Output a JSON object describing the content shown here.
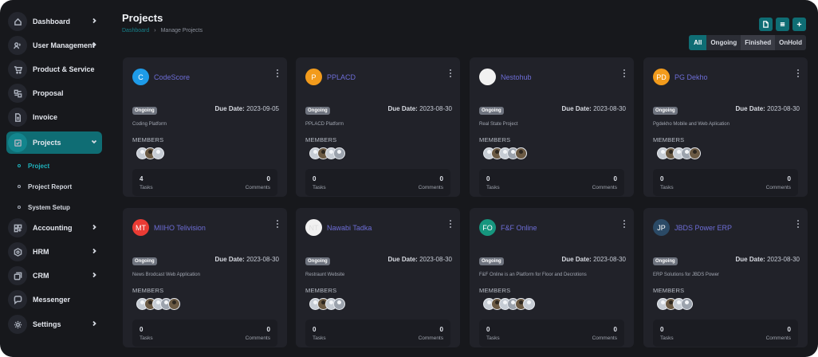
{
  "sidebar": {
    "items": [
      {
        "label": "Dashboard",
        "icon": "home-icon",
        "chevron": true
      },
      {
        "label": "User Management",
        "icon": "users-icon",
        "chevron": true
      },
      {
        "label": "Product & Service",
        "icon": "cart-icon",
        "chevron": false
      },
      {
        "label": "Proposal",
        "icon": "proposal-icon",
        "chevron": false
      },
      {
        "label": "Invoice",
        "icon": "invoice-icon",
        "chevron": false
      },
      {
        "label": "Projects",
        "icon": "projects-icon",
        "chevron": true,
        "active": true
      },
      {
        "label": "Accounting",
        "icon": "accounting-icon",
        "chevron": true
      },
      {
        "label": "HRM",
        "icon": "hrm-icon",
        "chevron": true
      },
      {
        "label": "CRM",
        "icon": "crm-icon",
        "chevron": true
      },
      {
        "label": "Messenger",
        "icon": "messenger-icon",
        "chevron": false
      },
      {
        "label": "Settings",
        "icon": "gear-icon",
        "chevron": true
      }
    ],
    "sub_items": [
      {
        "label": "Project",
        "active": true
      },
      {
        "label": "Project Report"
      },
      {
        "label": "System Setup"
      }
    ]
  },
  "header": {
    "title": "Projects",
    "breadcrumb": {
      "home": "Dashboard",
      "separator": "›",
      "current": "Manage Projects"
    },
    "tools": [
      "export-icon",
      "list-icon",
      "plus-icon"
    ],
    "filters": [
      "All",
      "Ongoing",
      "Finished",
      "OnHold"
    ]
  },
  "colors": {
    "accent": "#0f6d74",
    "accent_text": "#1fb3bd",
    "project_name": "#6d6dd6"
  },
  "projects": [
    {
      "initials": "C",
      "avatar_color": "#1e9be8",
      "name": "CodeScore",
      "status": "Ongoing",
      "due_label": "Due Date:",
      "due": "2023-09-05",
      "desc": "Coding Platform",
      "members_label": "MEMBERS",
      "members": 3,
      "tasks": "4",
      "tasks_label": "Tasks",
      "comments": "0",
      "comments_label": "Comments"
    },
    {
      "initials": "P",
      "avatar_color": "#f29b1c",
      "name": "PPLACD",
      "status": "Ongoing",
      "due_label": "Due Date:",
      "due": "2023-08-30",
      "desc": "PPLACD Platform",
      "members_label": "MEMBERS",
      "members": 4,
      "tasks": "0",
      "tasks_label": "Tasks",
      "comments": "0",
      "comments_label": "Comments"
    },
    {
      "initials": "",
      "avatar_color": "#f1f1f1",
      "name": "Nestohub",
      "status": "Ongoing",
      "due_label": "Due Date:",
      "due": "2023-08-30",
      "desc": "Real State Project",
      "members_label": "MEMBERS",
      "members": 5,
      "tasks": "0",
      "tasks_label": "Tasks",
      "comments": "0",
      "comments_label": "Comments"
    },
    {
      "initials": "PD",
      "avatar_color": "#f29b1c",
      "name": "PG Dekho",
      "status": "Ongoing",
      "due_label": "Due Date:",
      "due": "2023-08-30",
      "desc": "Pgdekho Mobile and Web Aplication",
      "members_label": "MEMBERS",
      "members": 5,
      "tasks": "0",
      "tasks_label": "Tasks",
      "comments": "0",
      "comments_label": "Comments"
    },
    {
      "initials": "MT",
      "avatar_color": "#ea3b34",
      "name": "MIIHO Telivision",
      "status": "Ongoing",
      "due_label": "Due Date:",
      "due": "2023-08-30",
      "desc": "News Brodcast Web Application",
      "members_label": "MEMBERS",
      "members": 5,
      "tasks": "0",
      "tasks_label": "Tasks",
      "comments": "0",
      "comments_label": "Comments"
    },
    {
      "initials": "NT",
      "avatar_color": "#f1f1f1",
      "name": "Nawabi Tadka",
      "status": "Ongoing",
      "due_label": "Due Date:",
      "due": "2023-08-30",
      "desc": "Restraunt Website",
      "members_label": "MEMBERS",
      "members": 4,
      "tasks": "0",
      "tasks_label": "Tasks",
      "comments": "0",
      "comments_label": "Comments"
    },
    {
      "initials": "FO",
      "avatar_color": "#16967e",
      "name": "F&F Online",
      "status": "Ongoing",
      "due_label": "Due Date:",
      "due": "2023-08-30",
      "desc": "F&F Online is an Platform for Floor and Decrotions",
      "members_label": "MEMBERS",
      "members": 6,
      "tasks": "0",
      "tasks_label": "Tasks",
      "comments": "0",
      "comments_label": "Comments"
    },
    {
      "initials": "JP",
      "avatar_color": "#2b4a66",
      "name": "JBDS Power ERP",
      "status": "Ongoing",
      "due_label": "Due Date:",
      "due": "2023-08-30",
      "desc": "ERP Solutions for JBDS Power",
      "members_label": "MEMBERS",
      "members": 4,
      "tasks": "0",
      "tasks_label": "Tasks",
      "comments": "0",
      "comments_label": "Comments"
    }
  ]
}
